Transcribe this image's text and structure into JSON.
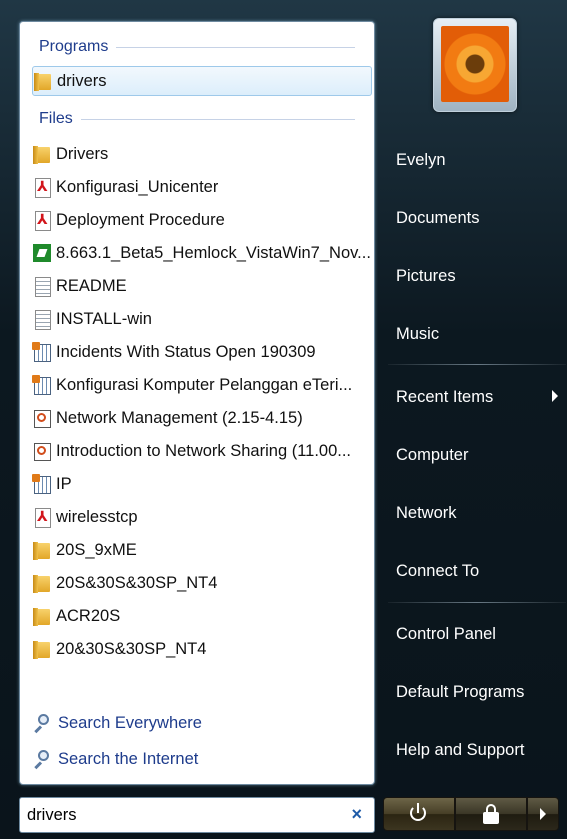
{
  "left_panel": {
    "programs_header": "Programs",
    "files_header": "Files",
    "programs": [
      {
        "label": "drivers",
        "icon": "folder-icon"
      }
    ],
    "files": [
      {
        "label": "Drivers",
        "icon": "folder-icon"
      },
      {
        "label": "Konfigurasi_Unicenter",
        "icon": "pdf-icon"
      },
      {
        "label": "Deployment Procedure",
        "icon": "pdf-icon"
      },
      {
        "label": "8.663.1_Beta5_Hemlock_VistaWin7_Nov...",
        "icon": "installer-icon"
      },
      {
        "label": "README",
        "icon": "text-document-icon"
      },
      {
        "label": "INSTALL-win",
        "icon": "text-document-icon"
      },
      {
        "label": "Incidents With Status Open 190309",
        "icon": "spreadsheet-icon"
      },
      {
        "label": "Konfigurasi Komputer Pelanggan eTeri...",
        "icon": "report-icon"
      },
      {
        "label": "Network Management (2.15-4.15)",
        "icon": "presentation-icon"
      },
      {
        "label": "Introduction to Network Sharing (11.00...",
        "icon": "presentation-icon"
      },
      {
        "label": "IP",
        "icon": "report-icon"
      },
      {
        "label": "wirelesstcp",
        "icon": "pdf-icon"
      },
      {
        "label": "20S_9xME",
        "icon": "folder-icon"
      },
      {
        "label": "20S&30S&30SP_NT4",
        "icon": "folder-icon"
      },
      {
        "label": "ACR20S",
        "icon": "folder-icon"
      },
      {
        "label": "20&30S&30SP_NT4",
        "icon": "folder-icon"
      }
    ],
    "search_links": [
      {
        "label": "Search Everywhere",
        "icon": "search-icon"
      },
      {
        "label": "Search the Internet",
        "icon": "search-icon"
      }
    ]
  },
  "search": {
    "value": "drivers",
    "clear_glyph": "×"
  },
  "right_panel": {
    "user": "Evelyn",
    "items_group1": [
      "Documents",
      "Pictures",
      "Music"
    ],
    "recent_items": "Recent Items",
    "items_group2": [
      "Computer",
      "Network",
      "Connect To"
    ],
    "items_group3": [
      "Control Panel",
      "Default Programs",
      "Help and Support"
    ]
  },
  "colors": {
    "header_blue": "#1e3c8c",
    "selection": "#dceefb",
    "frame_dark": "#0c1820"
  }
}
